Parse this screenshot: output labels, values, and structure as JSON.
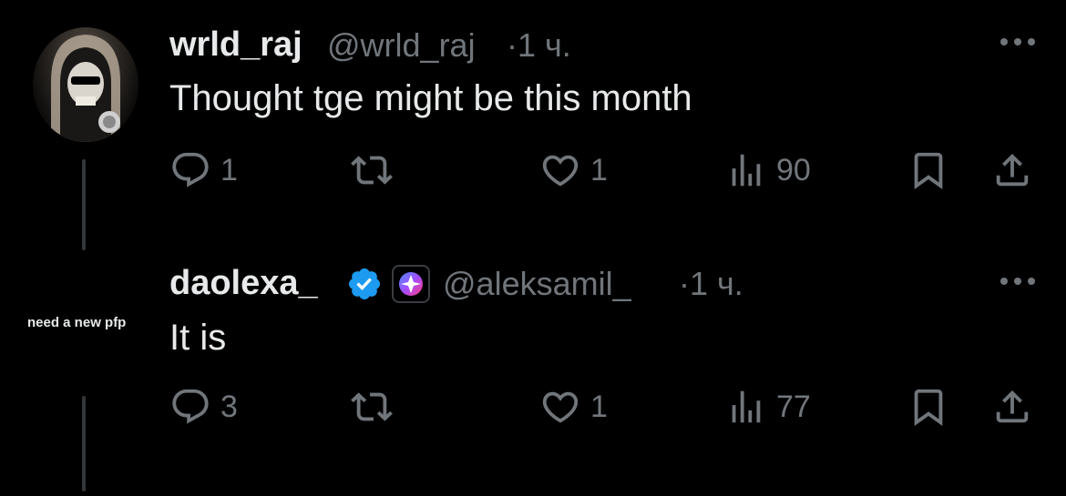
{
  "tweets": [
    {
      "display_name": "wrld_raj",
      "handle": "@wrld_raj",
      "time": "·1 ч.",
      "text": "Thought tge might be this month",
      "replies": "1",
      "retweets": "",
      "likes": "1",
      "views": "90"
    },
    {
      "display_name": "daolexa_",
      "handle": "@aleksamil_",
      "time": "·1 ч.",
      "text": "It is",
      "replies": "3",
      "retweets": "",
      "likes": "1",
      "views": "77",
      "avatar_text": "need a new pfp"
    }
  ],
  "colors": {
    "background": "#000000",
    "text_primary": "#e7e9ea",
    "text_secondary": "#71767b",
    "verified_blue": "#1d9bf0"
  },
  "icons": [
    "reply-icon",
    "retweet-icon",
    "like-icon",
    "views-icon",
    "bookmark-icon",
    "share-icon",
    "more-icon",
    "verified-badge-icon",
    "affiliate-badge-icon"
  ]
}
